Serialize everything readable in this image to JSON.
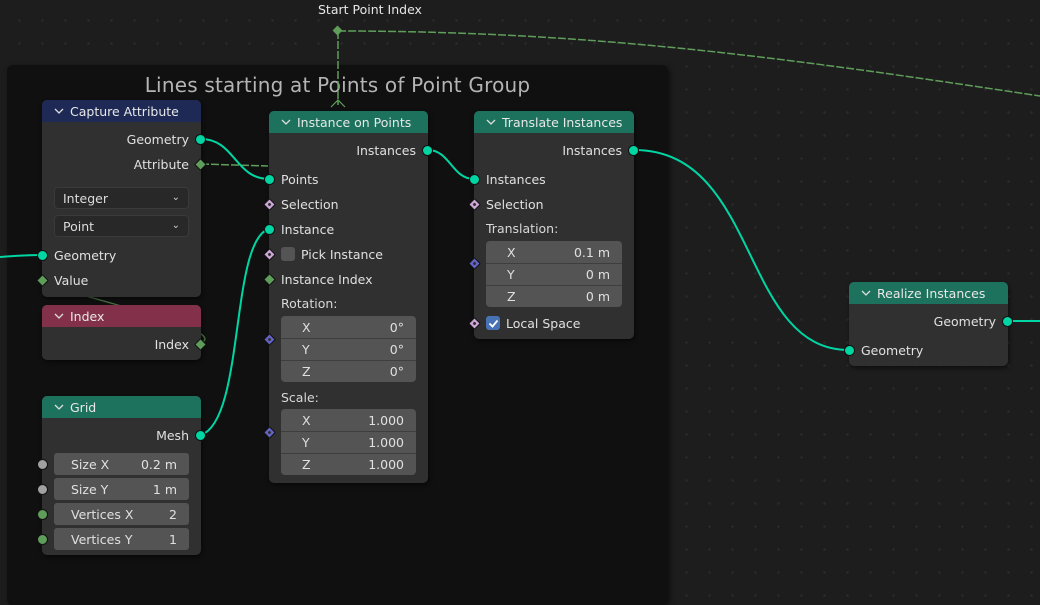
{
  "canvas": {
    "background": "#1d1d1d"
  },
  "frame": {
    "title": "Lines starting at Points of Point Group"
  },
  "reroute": {
    "label": "Start Point Index"
  },
  "socket_colors": {
    "geometry": "#00d6a3",
    "integer": "#5f9e5a",
    "boolean": "#cca6d6",
    "vector": "#6363c7",
    "float": "#a1a1a1"
  },
  "nodes": {
    "capture_attribute": {
      "title": "Capture Attribute",
      "header_color": "#1e2a55",
      "outputs": [
        "Geometry",
        "Attribute"
      ],
      "data_type": "Integer",
      "domain": "Point",
      "inputs": [
        "Geometry",
        "Value"
      ]
    },
    "index": {
      "title": "Index",
      "header_color": "#83314a",
      "outputs": [
        "Index"
      ]
    },
    "grid": {
      "title": "Grid",
      "header_color": "#1d725e",
      "outputs": [
        "Mesh"
      ],
      "fields": [
        {
          "label": "Size X",
          "value": "0.2 m"
        },
        {
          "label": "Size Y",
          "value": "1 m"
        },
        {
          "label": "Vertices X",
          "value": "2"
        },
        {
          "label": "Vertices Y",
          "value": "1"
        }
      ]
    },
    "instance_on_points": {
      "title": "Instance on Points",
      "header_color": "#1d725e",
      "outputs": [
        "Instances"
      ],
      "inputs": {
        "points": "Points",
        "selection": "Selection",
        "instance": "Instance",
        "pick_instance": "Pick Instance",
        "pick_instance_checked": false,
        "instance_index": "Instance Index"
      },
      "rotation": {
        "label": "Rotation:",
        "rows": [
          {
            "axis": "X",
            "value": "0°"
          },
          {
            "axis": "Y",
            "value": "0°"
          },
          {
            "axis": "Z",
            "value": "0°"
          }
        ]
      },
      "scale": {
        "label": "Scale:",
        "rows": [
          {
            "axis": "X",
            "value": "1.000"
          },
          {
            "axis": "Y",
            "value": "1.000"
          },
          {
            "axis": "Z",
            "value": "1.000"
          }
        ]
      }
    },
    "translate_instances": {
      "title": "Translate Instances",
      "header_color": "#1d725e",
      "outputs": [
        "Instances"
      ],
      "inputs": {
        "instances": "Instances",
        "selection": "Selection"
      },
      "translation": {
        "label": "Translation:",
        "rows": [
          {
            "axis": "X",
            "value": "0.1 m"
          },
          {
            "axis": "Y",
            "value": "0 m"
          },
          {
            "axis": "Z",
            "value": "0 m"
          }
        ]
      },
      "local_space": {
        "label": "Local Space",
        "checked": true
      }
    },
    "realize_instances": {
      "title": "Realize Instances",
      "header_color": "#1d725e",
      "outputs": [
        "Geometry"
      ],
      "inputs": [
        "Geometry"
      ]
    }
  }
}
